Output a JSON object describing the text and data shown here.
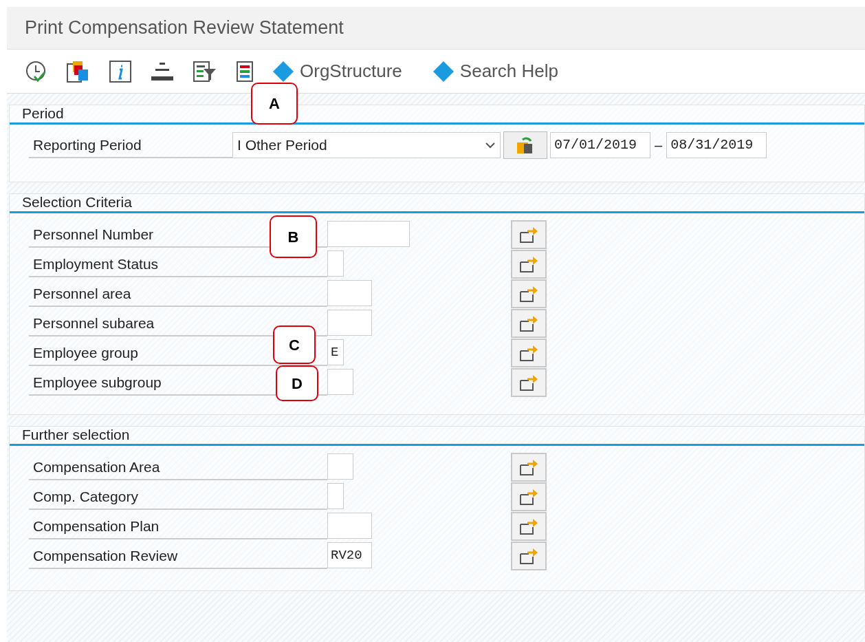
{
  "window": {
    "title": "Print Compensation Review Statement"
  },
  "toolbar": {
    "icons": [
      {
        "kind": "execute"
      },
      {
        "kind": "copy"
      },
      {
        "kind": "info"
      },
      {
        "kind": "align"
      },
      {
        "kind": "filter"
      },
      {
        "kind": "layout"
      }
    ],
    "buttons": [
      "OrgStructure",
      "Search Help"
    ]
  },
  "period": {
    "title": "Period",
    "label": "Reporting Period",
    "dropdown": "I Other Period",
    "from": "07/01/2019",
    "separator": "–",
    "to": "08/31/2019"
  },
  "sections": [
    {
      "title": "Selection Criteria",
      "rows": [
        {
          "label": "Personnel Number"
        },
        {
          "label": "Employment Status"
        },
        {
          "label": "Personnel area"
        },
        {
          "label": "Personnel subarea"
        },
        {
          "label": "Employee group",
          "value": "E"
        },
        {
          "label": "Employee subgroup"
        }
      ]
    },
    {
      "title": "Further selection",
      "rows": [
        {
          "label": "Compensation Area"
        },
        {
          "label": "Comp. Category"
        },
        {
          "label": "Compensation Plan"
        },
        {
          "label": "Compensation Review",
          "value": "RV20"
        }
      ]
    }
  ],
  "callouts": [
    "A",
    "B",
    "C",
    "D"
  ]
}
